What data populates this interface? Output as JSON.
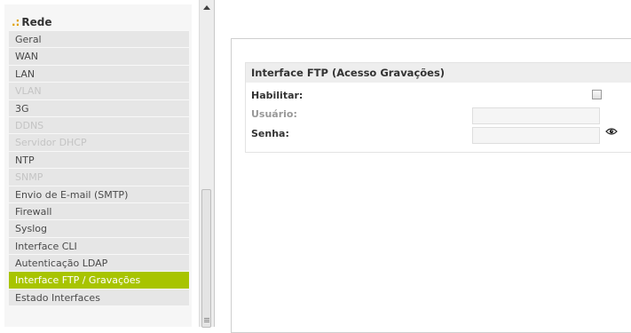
{
  "sidebar": {
    "header": "Rede",
    "items": [
      {
        "label": "Geral",
        "state": "normal"
      },
      {
        "label": "WAN",
        "state": "normal"
      },
      {
        "label": "LAN",
        "state": "normal"
      },
      {
        "label": "VLAN",
        "state": "disabled"
      },
      {
        "label": "3G",
        "state": "normal"
      },
      {
        "label": "DDNS",
        "state": "disabled"
      },
      {
        "label": "Servidor DHCP",
        "state": "disabled"
      },
      {
        "label": "NTP",
        "state": "normal"
      },
      {
        "label": "SNMP",
        "state": "disabled"
      },
      {
        "label": "Envio de E-mail (SMTP)",
        "state": "normal"
      },
      {
        "label": "Firewall",
        "state": "normal"
      },
      {
        "label": "Syslog",
        "state": "normal"
      },
      {
        "label": "Interface CLI",
        "state": "normal"
      },
      {
        "label": "Autenticação LDAP",
        "state": "normal"
      },
      {
        "label": "Interface FTP / Gravações",
        "state": "active"
      },
      {
        "label": "Estado Interfaces",
        "state": "normal"
      }
    ]
  },
  "panel": {
    "title": "Interface FTP (Acesso Gravações)",
    "enable_label": "Habilitar:",
    "enable_checked": false,
    "user_label": "Usuário:",
    "user_value": "",
    "password_label": "Senha:",
    "password_value": ""
  },
  "colors": {
    "active_item": "#a8c400",
    "bullet": "#e0a000"
  },
  "icons": {
    "password_toggle": "eye-icon"
  }
}
